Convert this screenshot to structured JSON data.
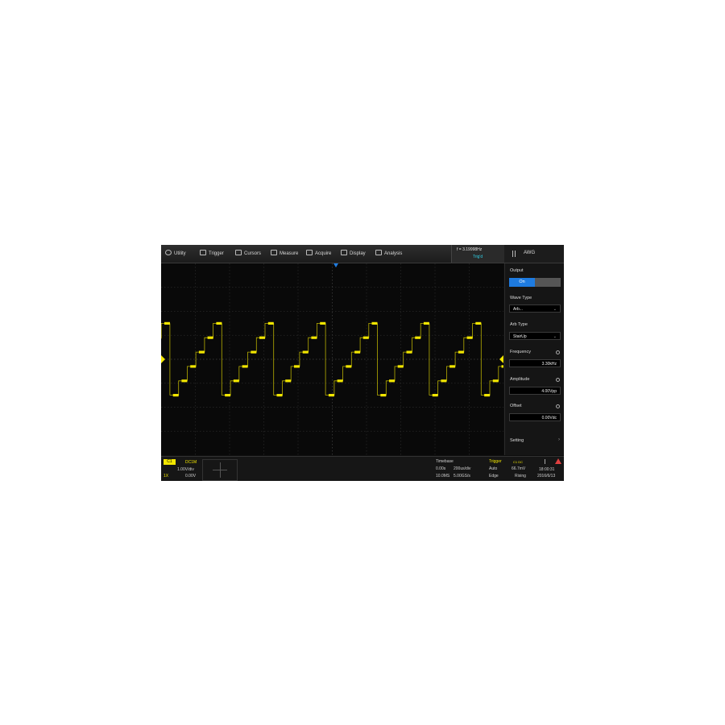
{
  "menu": {
    "utility": "Utility",
    "trigger": "Trigger",
    "cursors": "Cursors",
    "measure": "Measure",
    "acquire": "Acquire",
    "display": "Display",
    "analysis": "Analysis"
  },
  "freq_counter": {
    "value": "f = 3.19998Hz",
    "label": "Trig'd"
  },
  "awg_tab": "AWG",
  "panel": {
    "output_label": "Output",
    "output_on": "On",
    "output_off": "",
    "wave_type_label": "Wave Type",
    "wave_type_value": "Arb...",
    "arb_type_label": "Arb Type",
    "arb_type_value": "StairUp",
    "frequency_label": "Frequency",
    "frequency_value": "3.30kHz",
    "amplitude_label": "Amplitude",
    "amplitude_value": "4.00Vpp",
    "offset_label": "Offset",
    "offset_value": "0.00Vdc",
    "setting_label": "Setting"
  },
  "channel": {
    "id": "C1",
    "coupling": "DC1M",
    "scale": "1.00V/div",
    "probe": "1X",
    "offset": "0.00V"
  },
  "timebase": {
    "label": "Timebase",
    "delay": "0.00s",
    "scale": "200us/div",
    "memory": "10.0MS",
    "rate": "5.00GS/s"
  },
  "trigger_info": {
    "label": "Trigger",
    "source": "C1 DC",
    "mode": "Auto",
    "level": "66.7mV",
    "type": "Edge",
    "slope": "Rising"
  },
  "clock": {
    "time": "18:00:31",
    "date": "2016/6/13"
  },
  "colors": {
    "trace": "#f2e600",
    "accent": "#1e7be0",
    "counter": "#2fd0e6"
  },
  "waveform": {
    "type": "StairUp",
    "periods_visible": 6.6,
    "steps_per_period": 6,
    "low_div": -1.5,
    "high_div": 1.5
  }
}
